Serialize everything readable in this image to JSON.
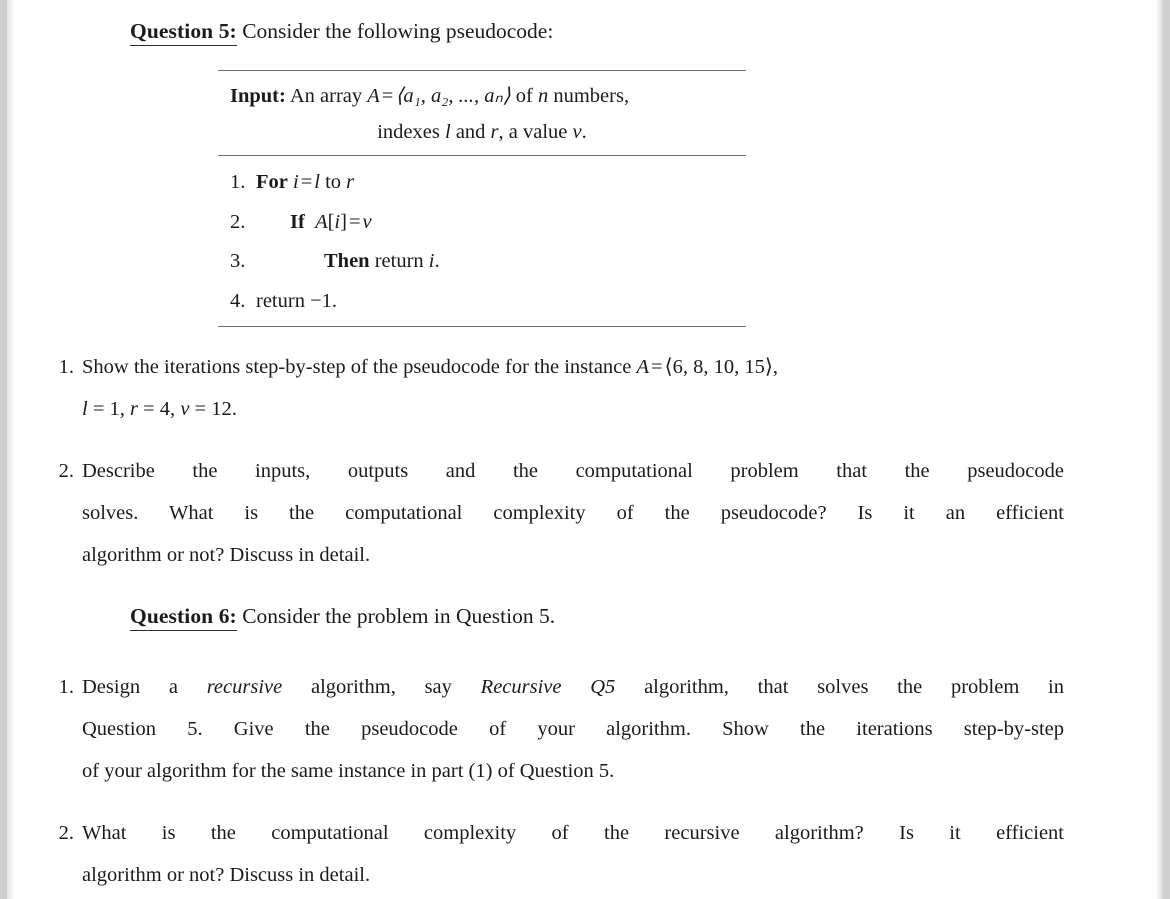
{
  "document": {
    "type": "homework-assignment-page",
    "questions": [
      {
        "id": "question-5",
        "label": "Question 5:",
        "prompt": "Consider the following pseudocode:",
        "pseudocode": {
          "input_label": "Input:",
          "input_line1_a": "An array",
          "input_line1_var": "A",
          "input_line1_eq": "=",
          "input_line1_array": "⟨a₁, a₂, ..., aₙ⟩",
          "input_line1_b": "of",
          "input_line1_n": "n",
          "input_line1_c": "numbers,",
          "input_line2_a": "indexes",
          "input_line2_l": "l",
          "input_line2_and": "and",
          "input_line2_r": "r",
          "input_line2_b": ", a value",
          "input_line2_v": "v",
          "input_line2_c": ".",
          "steps": [
            {
              "number": "1.",
              "indent": 1,
              "keyword": "For",
              "expr_i": "i",
              "expr_eq": "=",
              "expr_l": "l",
              "expr_to": "to",
              "expr_r": "r"
            },
            {
              "number": "2.",
              "indent": 2,
              "keyword": "If",
              "expr_A": "A",
              "expr_bracket_open": "[",
              "expr_i": "i",
              "expr_bracket_close": "]",
              "expr_eq": "=",
              "expr_v": "v"
            },
            {
              "number": "3.",
              "indent": 3,
              "keyword": "Then",
              "expr_return": "return",
              "expr_i": "i",
              "expr_dot": "."
            },
            {
              "number": "4.",
              "indent": 1,
              "keyword": "",
              "plain": "return",
              "expr_minus_one": "−1",
              "expr_dot": "."
            }
          ]
        },
        "items": [
          {
            "marker": "1.",
            "line1_a": "Show the iterations step-by-step of the pseudocode for the instance",
            "line1_var": "A",
            "line1_eq": "=",
            "line1_array": "⟨6, 8, 10, 15⟩,",
            "line2_l": "l",
            "line2_l_val": "= 1,",
            "line2_r": "r",
            "line2_r_val": "= 4,",
            "line2_v": "v",
            "line2_v_val": "= 12."
          },
          {
            "marker": "2.",
            "line1": "Describe the inputs, outputs and the computational problem that the pseudocode",
            "line2": "solves.  What is the computational complexity of the pseudocode?  Is it an efficient",
            "line3": "algorithm or not? Discuss in detail."
          }
        ]
      },
      {
        "id": "question-6",
        "label": "Question 6:",
        "prompt": "Consider the problem in Question 5.",
        "items": [
          {
            "marker": "1.",
            "line1_a": "Design a",
            "line1_it1": "recursive",
            "line1_b": "algorithm, say",
            "line1_it2": "Recursive Q5",
            "line1_c": "algorithm, that solves the problem in",
            "line2": "Question 5.  Give the pseudocode of your algorithm. Show the iterations step-by-step",
            "line3": "of your algorithm for the same instance in part (1) of Question 5."
          },
          {
            "marker": "2.",
            "line1": "What is the computational complexity of the recursive algorithm?   Is it efficient",
            "line2": "algorithm or not? Discuss in detail."
          }
        ]
      }
    ]
  },
  "colors": {
    "page_background": "#ffffff",
    "gutter": "#cdcdcd",
    "text": "#1b1b1b",
    "rule": "#6e6e6e"
  }
}
